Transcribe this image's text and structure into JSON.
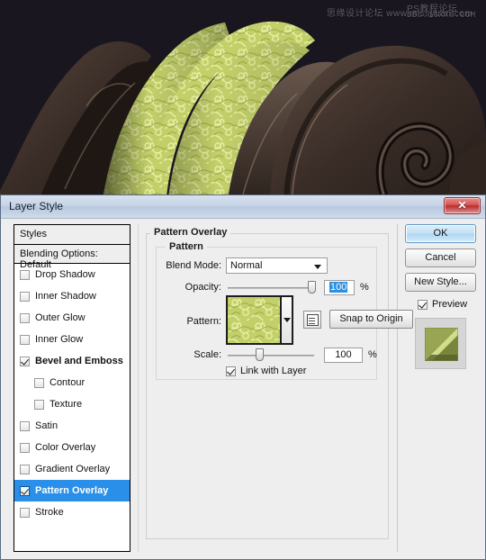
{
  "artwork": {
    "description": "decorative-letterform-with-green-floral-pattern",
    "background_color": "#1a1620",
    "pattern_color_light": "#dce88a",
    "pattern_color_mid": "#b3c455",
    "pattern_color_dark": "#6f8030",
    "dark_shape_color": "#463730",
    "watermarks": {
      "line1": "思缘设计论坛  www.missyuan.com",
      "line2": "PS教程论坛",
      "line3": "BBS.16XX8.COM"
    }
  },
  "dialog": {
    "title": "Layer Style",
    "close_label": "✕"
  },
  "styles_panel": {
    "header": "Styles",
    "blending_options": "Blending Options: Default",
    "items": [
      {
        "label": "Drop Shadow",
        "checked": false,
        "indent": false,
        "selected": false
      },
      {
        "label": "Inner Shadow",
        "checked": false,
        "indent": false,
        "selected": false
      },
      {
        "label": "Outer Glow",
        "checked": false,
        "indent": false,
        "selected": false
      },
      {
        "label": "Inner Glow",
        "checked": false,
        "indent": false,
        "selected": false
      },
      {
        "label": "Bevel and Emboss",
        "checked": true,
        "indent": false,
        "selected": false
      },
      {
        "label": "Contour",
        "checked": false,
        "indent": true,
        "selected": false
      },
      {
        "label": "Texture",
        "checked": false,
        "indent": true,
        "selected": false
      },
      {
        "label": "Satin",
        "checked": false,
        "indent": false,
        "selected": false
      },
      {
        "label": "Color Overlay",
        "checked": false,
        "indent": false,
        "selected": false
      },
      {
        "label": "Gradient Overlay",
        "checked": false,
        "indent": false,
        "selected": false
      },
      {
        "label": "Pattern Overlay",
        "checked": true,
        "indent": false,
        "selected": true
      },
      {
        "label": "Stroke",
        "checked": false,
        "indent": false,
        "selected": false
      }
    ],
    "selection_color": "#2a8fe8"
  },
  "main_panel": {
    "section_title": "Pattern Overlay",
    "group_title": "Pattern",
    "blend_mode": {
      "label": "Blend Mode:",
      "value": "Normal"
    },
    "opacity": {
      "label": "Opacity:",
      "value": "100",
      "unit": "%",
      "slider_percent": 100,
      "selected": true
    },
    "pattern": {
      "label": "Pattern:",
      "swatch_name": "green-floral-pattern-swatch",
      "new_preset_tooltip": "create-new-preset",
      "snap_button": "Snap to Origin"
    },
    "scale": {
      "label": "Scale:",
      "value": "100",
      "unit": "%",
      "slider_percent": 33
    },
    "link_with_layer": {
      "label": "Link with Layer",
      "checked": true
    }
  },
  "right_panel": {
    "ok": "OK",
    "cancel": "Cancel",
    "new_style": "New Style...",
    "preview": {
      "label": "Preview",
      "checked": true
    },
    "preview_swatch_name": "layer-style-preview-thumbnail"
  }
}
